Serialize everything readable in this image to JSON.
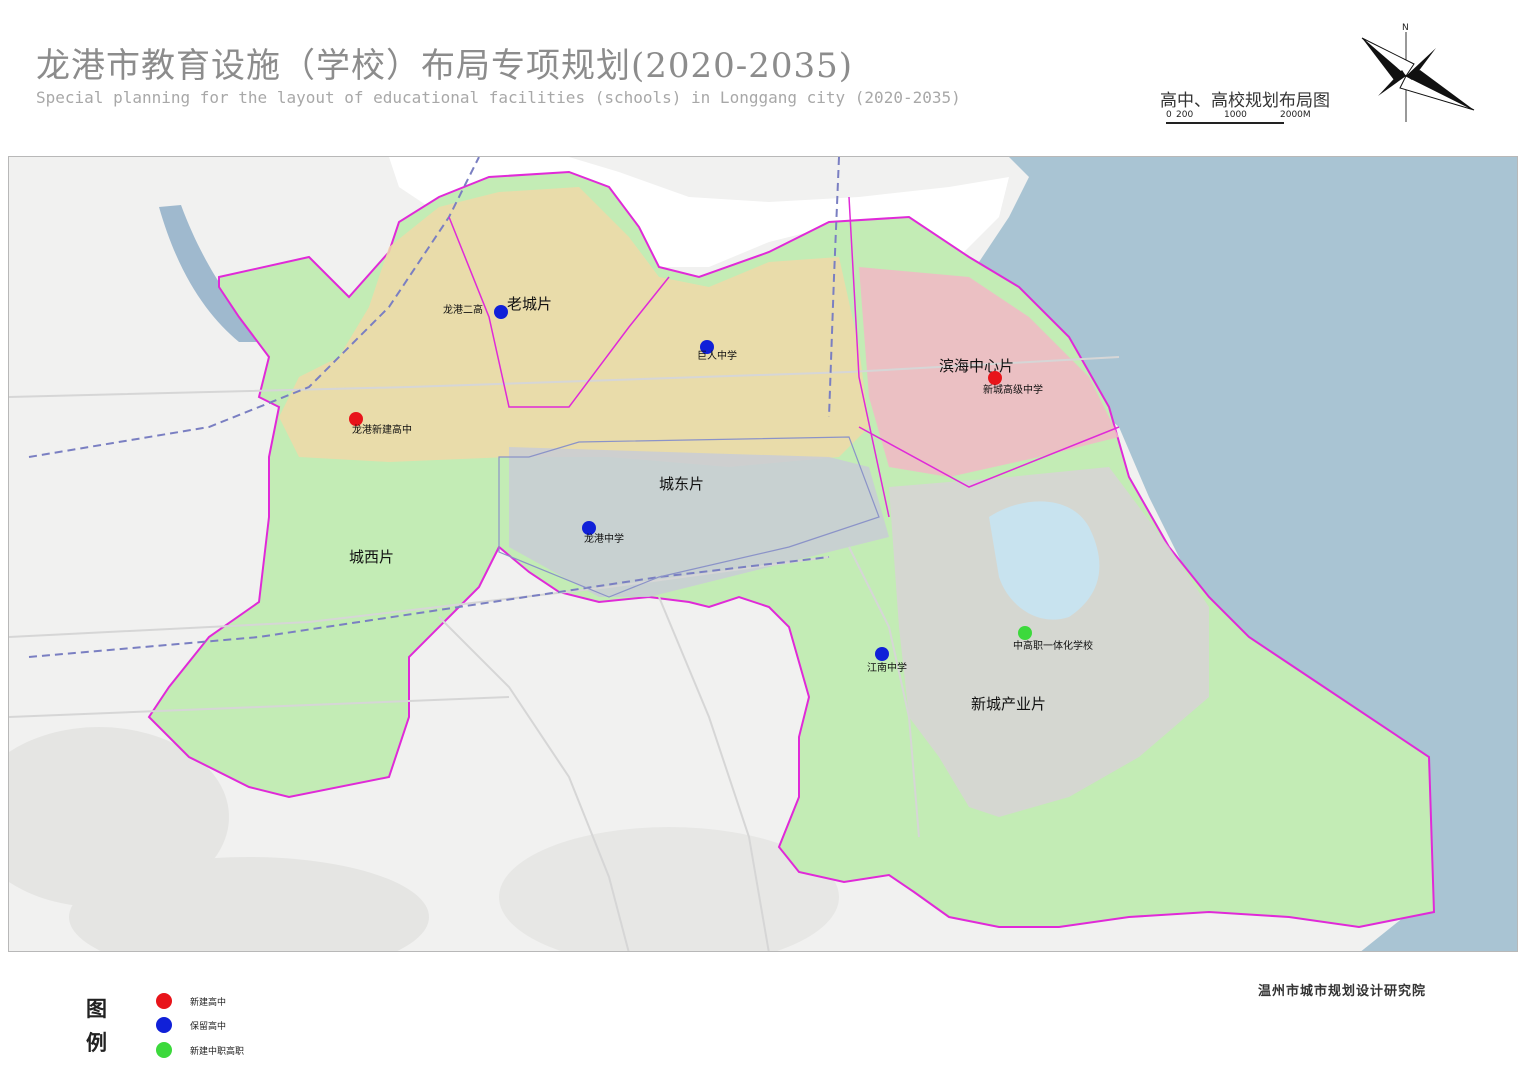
{
  "header": {
    "title_zh": "龙港市教育设施（学校）布局专项规划(2020-2035)",
    "title_en": "Special planning for the layout of educational facilities (schools) in Longgang city (2020-2035)",
    "map_subtitle": "高中、高校规划布局图"
  },
  "scale_bar": {
    "labels": [
      "0",
      "200",
      "1000",
      "2000M"
    ]
  },
  "north_arrow": {
    "label": "N",
    "icon": "north-arrow-icon"
  },
  "colors": {
    "new_high_school": "#e8141a",
    "retained_high_school": "#1020d8",
    "vocational_school": "#3cd93c",
    "district_boundary": "#e02ad8",
    "sea": "#a9c4d3",
    "planning_area": "#c3ecb5"
  },
  "districts": [
    {
      "name": "老城片"
    },
    {
      "name": "滨海中心片"
    },
    {
      "name": "城东片"
    },
    {
      "name": "城西片"
    },
    {
      "name": "新城产业片"
    }
  ],
  "schools": [
    {
      "name": "龙港二高",
      "category": "retained_high_school"
    },
    {
      "name": "巨人中学",
      "category": "retained_high_school"
    },
    {
      "name": "新城高级中学",
      "category": "new_high_school"
    },
    {
      "name": "龙港新建高中",
      "category": "new_high_school"
    },
    {
      "name": "龙港中学",
      "category": "retained_high_school"
    },
    {
      "name": "江南中学",
      "category": "retained_high_school"
    },
    {
      "name": "中高职一体化学校",
      "category": "vocational_school"
    }
  ],
  "legend": {
    "title": "图例",
    "items": [
      {
        "label": "新建高中",
        "category": "new_high_school"
      },
      {
        "label": "保留高中",
        "category": "retained_high_school"
      },
      {
        "label": "新建中职高职",
        "category": "vocational_school"
      }
    ]
  },
  "footer": {
    "institute": "温州市城市规划设计研究院"
  }
}
